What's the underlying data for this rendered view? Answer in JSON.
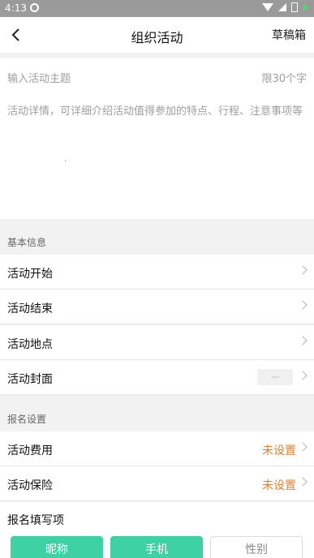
{
  "statusbar": {
    "time": "4:13"
  },
  "header": {
    "title": "组织活动",
    "drafts": "草稿箱"
  },
  "compose": {
    "subject_placeholder": "输入活动主题",
    "subject_limit": "限30个字",
    "detail_placeholder": "活动详情，可详细介绍活动值得参加的特点、行程、注意事项等"
  },
  "basic": {
    "section_title": "基本信息",
    "rows": [
      {
        "label": "活动开始"
      },
      {
        "label": "活动结束"
      },
      {
        "label": "活动地点"
      },
      {
        "label": "活动封面"
      }
    ]
  },
  "signup": {
    "section_title": "报名设置",
    "rows": [
      {
        "label": "活动费用",
        "value": "未设置"
      },
      {
        "label": "活动保险",
        "value": "未设置"
      }
    ]
  },
  "fields": {
    "title": "报名填写项",
    "chips": [
      {
        "label": "昵称",
        "selected": true
      },
      {
        "label": "手机",
        "selected": true
      },
      {
        "label": "性别",
        "selected": false
      }
    ]
  },
  "colors": {
    "accent": "#3dd1a3",
    "warning": "#e0802f",
    "statusbar": "#9a9a9a"
  }
}
